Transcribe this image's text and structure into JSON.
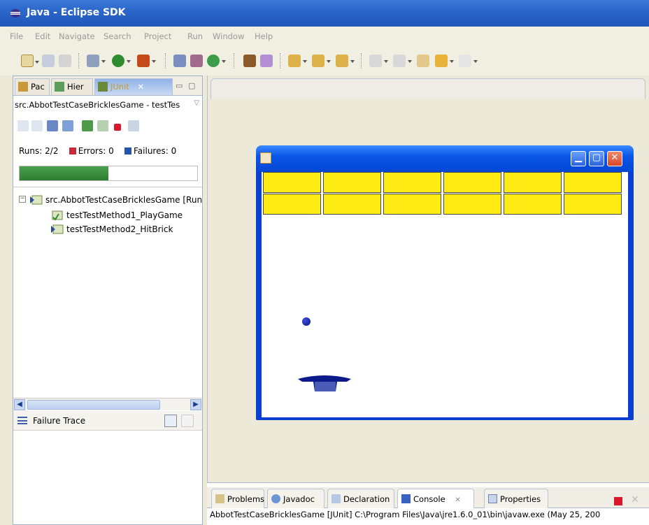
{
  "window": {
    "title": "Java - Eclipse SDK"
  },
  "menu": {
    "items": [
      "File",
      "Edit",
      "Navigate",
      "Search",
      "Project",
      "Run",
      "Window",
      "Help"
    ]
  },
  "left_panel": {
    "tabs": [
      {
        "label": "Pac"
      },
      {
        "label": "Hier"
      },
      {
        "label": "JUnit",
        "close": "✕"
      }
    ],
    "breadcrumb": "src.AbbotTestCaseBricklesGame - testTes",
    "runs_label": "Runs:",
    "runs_value": "2/2",
    "errors_label": "Errors:",
    "errors_value": "0",
    "failures_label": "Failures:",
    "failures_value": "0",
    "progress_fraction": 0.5,
    "tree": {
      "root": "src.AbbotTestCaseBricklesGame [Run",
      "children": [
        "testTestMethod1_PlayGame",
        "testTestMethod2_HitBrick"
      ]
    },
    "failure_trace_label": "Failure Trace"
  },
  "game": {
    "colors": {
      "brick": "#ffeb14",
      "ball": "#0b1478",
      "paddle": "#0a1a8a"
    },
    "brick_rows": 2,
    "brick_cols": 6
  },
  "bottom_panel": {
    "tabs": [
      "Problems",
      "Javadoc",
      "Declaration",
      "Console",
      "Properties"
    ],
    "console_close": "✕",
    "console_text": "AbbotTestCaseBricklesGame [JUnit] C:\\Program Files\\Java\\jre1.6.0_01\\bin\\javaw.exe (May 25, 200"
  }
}
